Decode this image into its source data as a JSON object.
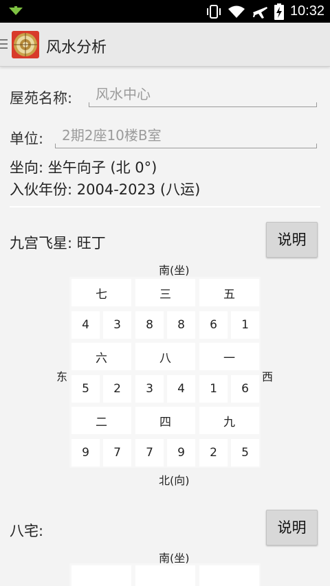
{
  "status_bar": {
    "time": "10:32"
  },
  "action_bar": {
    "title": "风水分析"
  },
  "form": {
    "name_label": "屋苑名称:",
    "name_value": "风水中心",
    "unit_label": "单位:",
    "unit_value": "2期2座10楼B室",
    "orientation": "坐向: 坐午向子 (北 0°)",
    "move_in": "入伙年份: 2004-2023 (八运)"
  },
  "flying_stars": {
    "title": "九宫飞星: 旺丁",
    "button": "说明",
    "dir_top": "南(坐)",
    "dir_bottom": "北(向)",
    "dir_left": "东",
    "dir_right": "西",
    "rows": [
      {
        "palaces": [
          "七",
          "三",
          "五"
        ],
        "numbers": [
          "4",
          "3",
          "8",
          "8",
          "6",
          "1"
        ]
      },
      {
        "palaces": [
          "六",
          "八",
          "一"
        ],
        "numbers": [
          "5",
          "2",
          "3",
          "4",
          "1",
          "6"
        ]
      },
      {
        "palaces": [
          "二",
          "四",
          "九"
        ],
        "numbers": [
          "9",
          "7",
          "7",
          "9",
          "2",
          "5"
        ]
      }
    ]
  },
  "eight_mansions": {
    "title": "八宅:",
    "button": "说明",
    "dir_top": "南(坐)"
  }
}
